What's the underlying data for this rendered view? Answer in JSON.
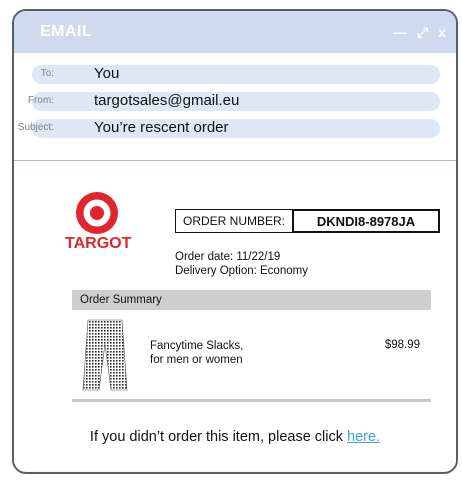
{
  "window": {
    "title": "EMAIL",
    "controls": {
      "minimize": "—",
      "expand": "⤢",
      "close": "x"
    }
  },
  "header": {
    "to_label": "To:",
    "to_value": "You",
    "from_label": "From:",
    "from_value": "targotsales@gmail.eu",
    "subject_label": "Subject:",
    "subject_value": "You’re rescent order"
  },
  "brand": {
    "name": "TARGOT",
    "color": "#e0262c"
  },
  "order": {
    "number_label": "ORDER NUMBER:",
    "number_value": "DKNDI8-8978JA",
    "date": "Order date:  11/22/19",
    "delivery": "Delivery Option: Economy"
  },
  "summary": {
    "heading": "Order Summary",
    "item_line1": "Fancytime Slacks,",
    "item_line2": "for men or women",
    "item_price": "$98.99",
    "item_icon": "pants-icon"
  },
  "footer": {
    "text": "If you didn’t order this item, please click ",
    "link": "here."
  }
}
